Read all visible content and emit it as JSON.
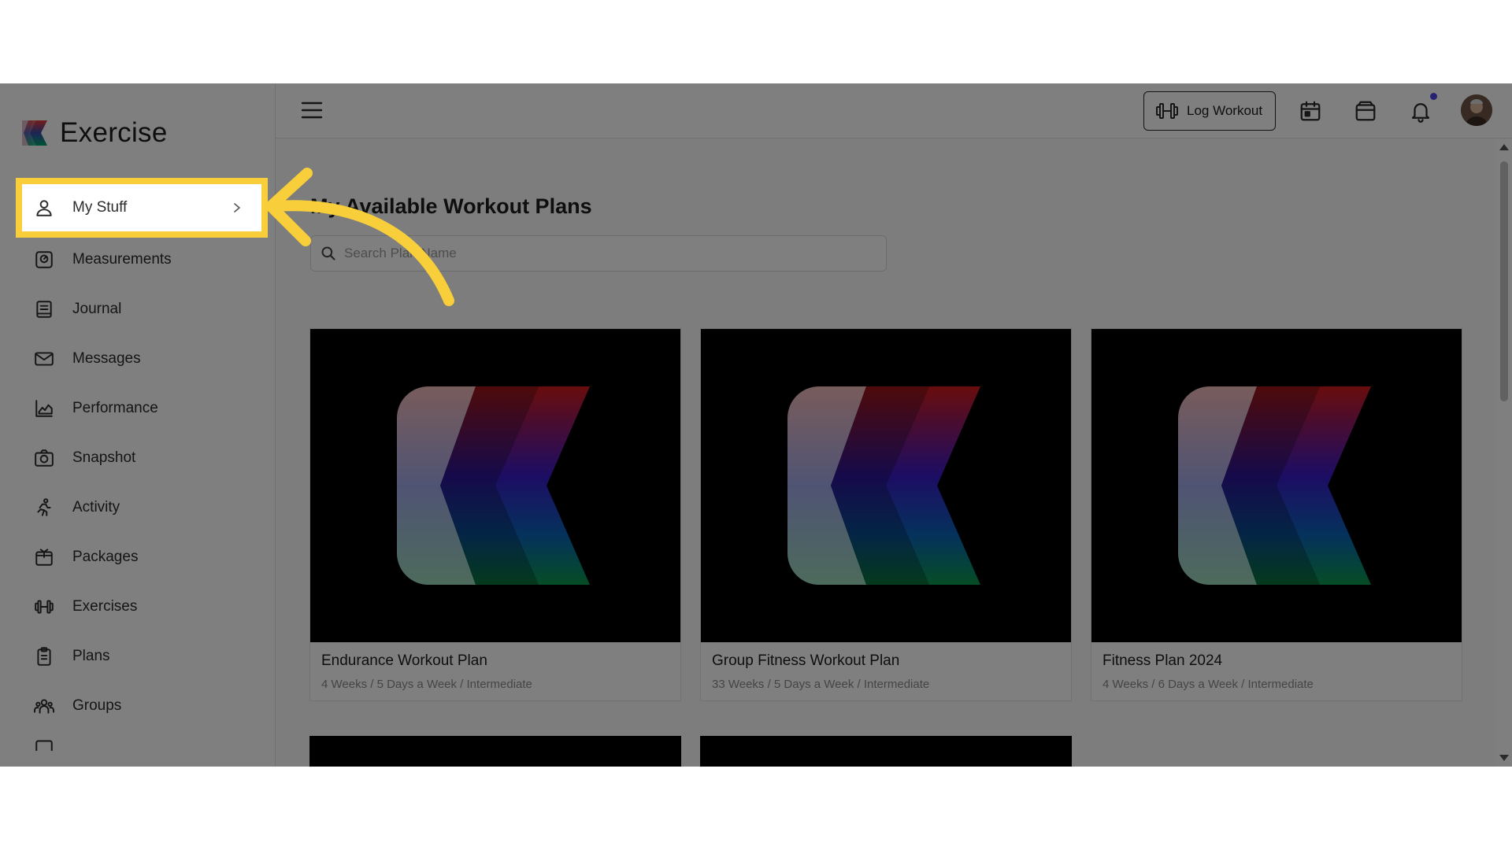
{
  "app": {
    "name": "Exercise"
  },
  "sidebar": {
    "items": [
      {
        "label": "My Stuff",
        "icon": "user-icon"
      },
      {
        "label": "Measurements",
        "icon": "scale-icon"
      },
      {
        "label": "Journal",
        "icon": "journal-icon"
      },
      {
        "label": "Messages",
        "icon": "mail-icon"
      },
      {
        "label": "Performance",
        "icon": "chart-icon"
      },
      {
        "label": "Snapshot",
        "icon": "camera-icon"
      },
      {
        "label": "Activity",
        "icon": "running-icon"
      },
      {
        "label": "Packages",
        "icon": "package-icon"
      },
      {
        "label": "Exercises",
        "icon": "dumbbell-icon"
      },
      {
        "label": "Plans",
        "icon": "clipboard-icon"
      },
      {
        "label": "Groups",
        "icon": "group-icon"
      }
    ]
  },
  "topbar": {
    "log_workout_label": "Log Workout"
  },
  "main": {
    "title": "My Available Workout Plans",
    "search_placeholder": "Search Plan Name",
    "cards": [
      {
        "title": "Endurance Workout Plan",
        "subtitle": "4 Weeks / 5 Days a Week / Intermediate"
      },
      {
        "title": "Group Fitness Workout Plan",
        "subtitle": "33 Weeks / 5 Days a Week / Intermediate"
      },
      {
        "title": "Fitness Plan 2024",
        "subtitle": "4 Weeks / 6 Days a Week / Intermediate"
      }
    ]
  },
  "colors": {
    "highlight": "#f8cf3a",
    "notification_dot": "#4f46e5",
    "overlay": "rgba(0,0,0,0.5)"
  }
}
